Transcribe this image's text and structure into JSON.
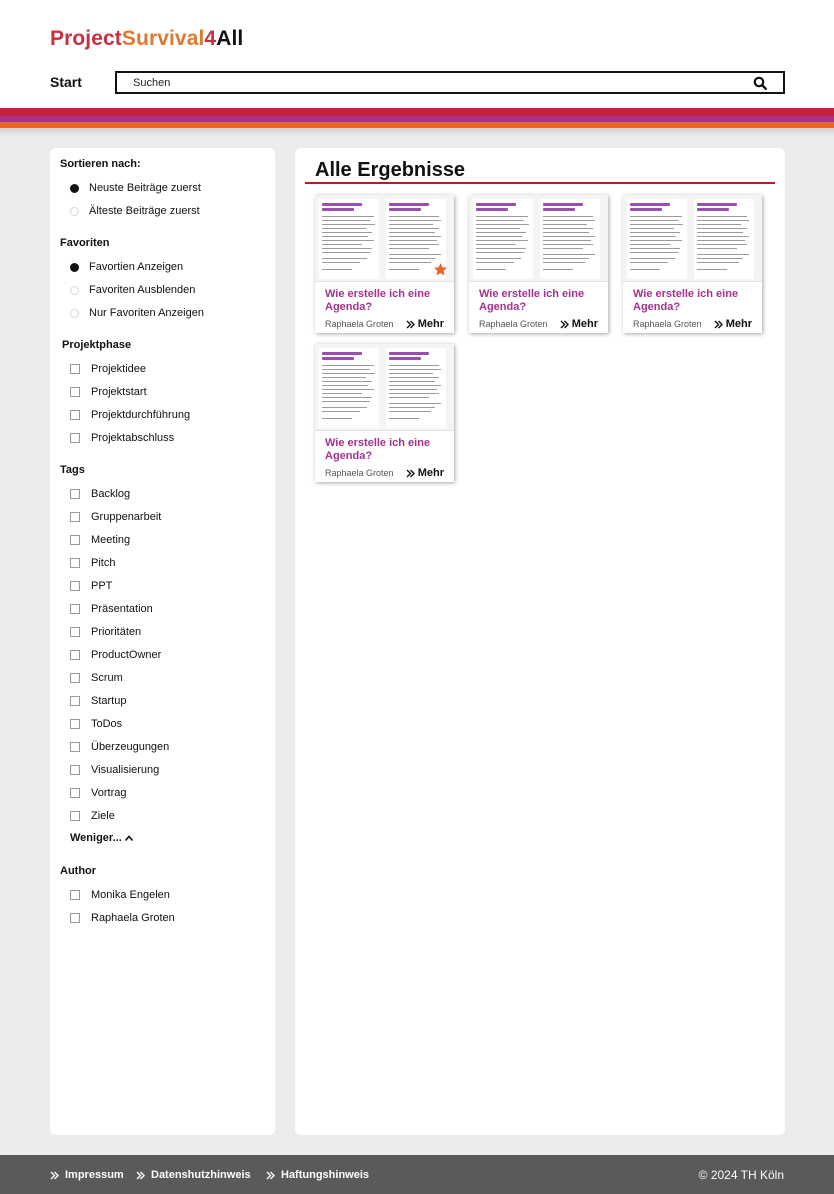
{
  "header": {
    "logo": {
      "part1": "Project",
      "part2": "Survival",
      "part3": "4",
      "part4": "All"
    },
    "nav_start": "Start",
    "search_placeholder": "Suchen"
  },
  "sidebar": {
    "sort_title": "Sortieren nach:",
    "sort_options": [
      {
        "label": "Neuste Beiträge zuerst",
        "selected": true
      },
      {
        "label": "Älteste Beiträge zuerst",
        "selected": false
      }
    ],
    "fav_title": "Favoriten",
    "fav_options": [
      {
        "label": "Favortien Anzeigen",
        "selected": true
      },
      {
        "label": "Favoriten Ausblenden",
        "selected": false
      },
      {
        "label": "Nur Favoriten Anzeigen",
        "selected": false
      }
    ],
    "phase_title": "Projektphase",
    "phase_options": [
      "Projektidee",
      "Projektstart",
      "Projektdurchführung",
      "Projektabschluss"
    ],
    "tags_title": "Tags",
    "tags": [
      "Backlog",
      "Gruppenarbeit",
      "Meeting",
      "Pitch",
      "PPT",
      "Präsentation",
      "Prioritäten",
      "ProductOwner",
      "Scrum",
      "Startup",
      "ToDos",
      "Überzeugungen",
      "Visualisierung",
      "Vortrag",
      "Ziele"
    ],
    "fewer_label": "Weniger...",
    "author_title": "Author",
    "authors": [
      "Monika Engelen",
      "Raphaela Groten"
    ]
  },
  "main": {
    "title": "Alle Ergebnisse",
    "cards": [
      {
        "title": "Wie erstelle ich eine Agenda?",
        "author": "Raphaela Groten",
        "more": "Mehr",
        "favorite": true
      },
      {
        "title": "Wie erstelle ich eine Agenda?",
        "author": "Raphaela Groten",
        "more": "Mehr",
        "favorite": false
      },
      {
        "title": "Wie erstelle ich eine Agenda?",
        "author": "Raphaela Groten",
        "more": "Mehr",
        "favorite": false
      },
      {
        "title": "Wie erstelle ich eine Agenda?",
        "author": "Raphaela Groten",
        "more": "Mehr",
        "favorite": false
      }
    ]
  },
  "footer": {
    "links": [
      "Impressum",
      "Datenshutzhinweis",
      "Haftungshinweis"
    ],
    "copyright": "© 2024 TH Köln"
  },
  "colors": {
    "red": "#c4223c",
    "purple": "#a8318d",
    "orange": "#e8662c",
    "footer": "#5a5a5a"
  },
  "icons": [
    "search-icon",
    "star-icon",
    "double-chevron-right-icon",
    "chevron-up-icon"
  ]
}
